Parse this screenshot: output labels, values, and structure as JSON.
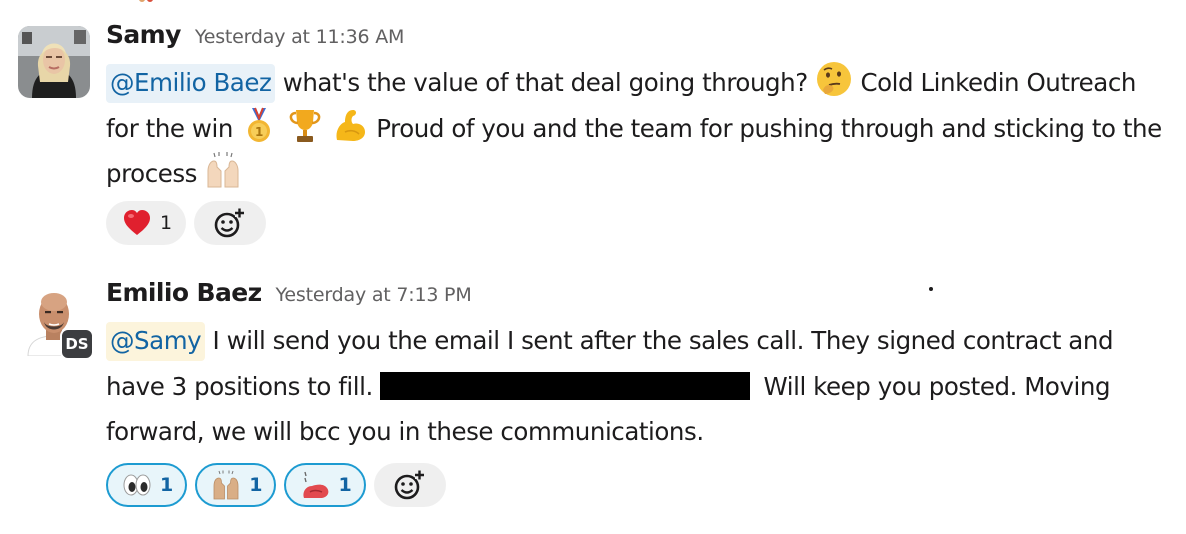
{
  "messages": [
    {
      "author": "Samy",
      "timestamp": "Yesterday at 11:36 AM",
      "mention": "@Emilio Baez",
      "text_1": "what's the value of that deal going through?",
      "emoji_1": "thinking-face",
      "text_2": "Cold Linkedin Outreach for the win",
      "emoji_2": [
        "first-place-medal",
        "trophy",
        "flexed-biceps"
      ],
      "text_3": "Proud of you and the team for pushing through and sticking to the process",
      "emoji_3": "raising-hands",
      "reactions": [
        {
          "emoji": "red-heart",
          "count": "1",
          "active": false
        }
      ],
      "add_reaction": "add-reaction-icon"
    },
    {
      "author": "Emilio Baez",
      "timestamp": "Yesterday at 7:13 PM",
      "avatar_badge": "DS",
      "mention": "@Samy",
      "text_1": "I will send you the email I sent after the sales call. They signed contract and have 3 positions to fill.",
      "redacted": true,
      "text_2": "Will keep you posted. Moving forward, we will bcc you in these communications.",
      "reactions": [
        {
          "emoji": "eyes",
          "count": "1",
          "active": true
        },
        {
          "emoji": "raising-hands",
          "count": "1",
          "active": true
        },
        {
          "emoji": "heated-tongue",
          "count": "1",
          "active": true
        }
      ],
      "add_reaction": "add-reaction-icon"
    }
  ],
  "colors": {
    "mention_bg": "#e8f1f8",
    "mention_self_bg": "#fcf4dc",
    "mention_text": "#1264a3",
    "active_reaction_border": "#1d9bd1",
    "active_reaction_bg": "#e8f5fa",
    "reaction_bg": "#efefef"
  }
}
